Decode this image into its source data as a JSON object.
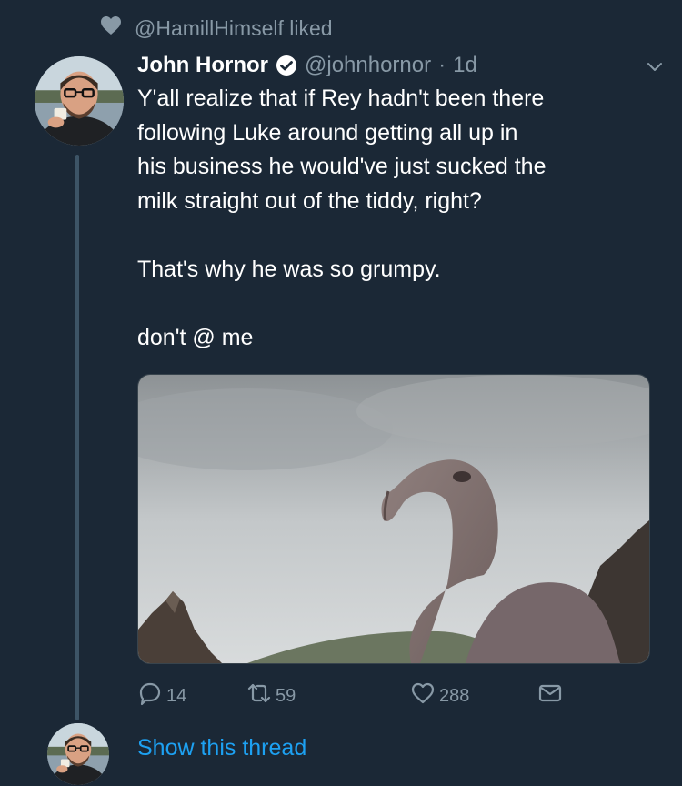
{
  "social_context": {
    "text": "@HamillHimself liked",
    "icon": "heart-icon"
  },
  "tweet": {
    "author_name": "John Hornor",
    "verified": true,
    "handle": "@johnhornor",
    "separator": "·",
    "time": "1d",
    "text_lines": [
      "Y'all realize that if Rey hadn't been there",
      "following Luke around getting all up in",
      "his business he would've just sucked the",
      "milk straight out of the tiddy, right?",
      "",
      "That's why he was so grumpy.",
      "",
      "don't @ me"
    ],
    "actions": {
      "replies": "14",
      "retweets": "59",
      "likes": "288"
    }
  },
  "thread": {
    "show_label": "Show this thread"
  },
  "colors": {
    "background": "#1b2836",
    "muted": "#8899a6",
    "link": "#1da1f2",
    "thread_line": "#3d5466"
  }
}
